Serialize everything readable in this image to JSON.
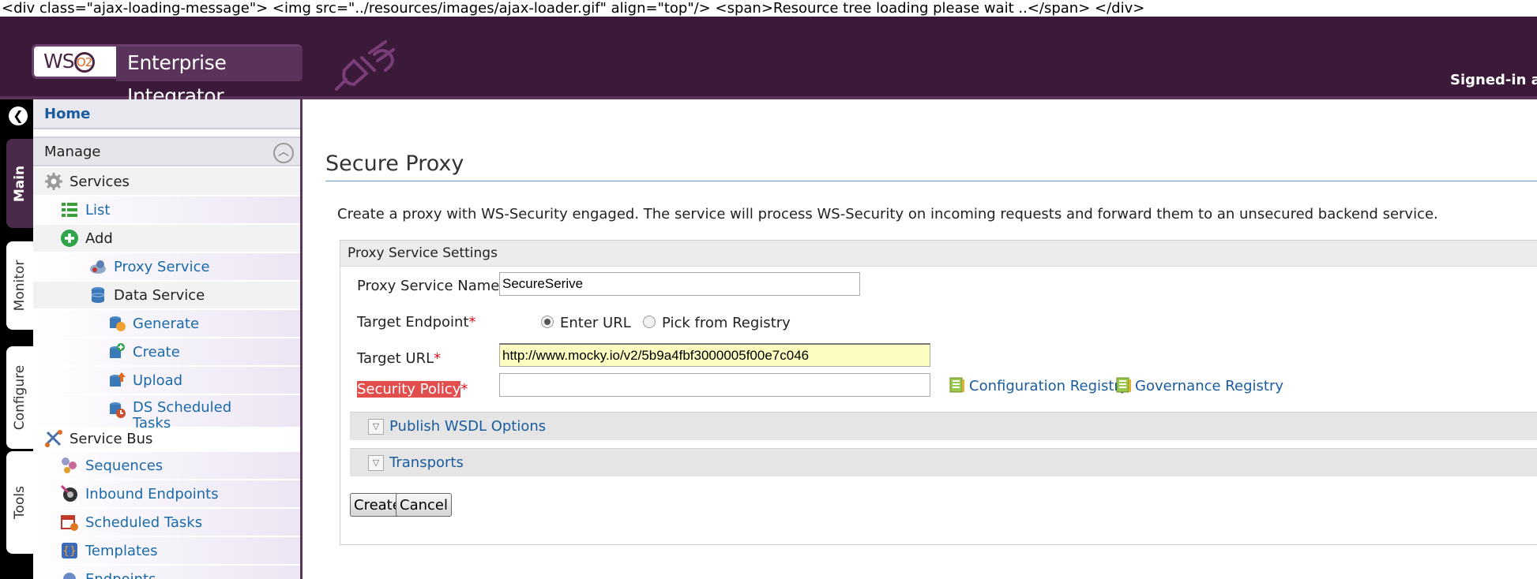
{
  "raw_markup_text": "<div class=\"ajax-loading-message\"> <img src=\"../resources/images/ajax-loader.gif\" align=\"top\"/> <span>Resource tree loading please wait ..</span> </div>",
  "header": {
    "logo_ws": "WS",
    "logo_o2": "O2",
    "logo_text": "Enterprise Integrator",
    "signed_in": "Signed-in a"
  },
  "side_tabs": [
    "Main",
    "Monitor",
    "Configure",
    "Tools"
  ],
  "sidebar": {
    "home": "Home",
    "manage": "Manage",
    "items": [
      {
        "label": "Services",
        "link": false,
        "icon": "gear-icon"
      },
      {
        "label": "List",
        "link": true,
        "icon": "list-icon"
      },
      {
        "label": "Add",
        "link": false,
        "icon": "add-icon"
      },
      {
        "label": "Proxy Service",
        "link": true,
        "icon": "proxy-service-icon"
      },
      {
        "label": "Data Service",
        "link": false,
        "icon": "database-icon"
      },
      {
        "label": "Generate",
        "link": true,
        "icon": "generate-icon"
      },
      {
        "label": "Create",
        "link": true,
        "icon": "create-icon"
      },
      {
        "label": "Upload",
        "link": true,
        "icon": "upload-icon"
      },
      {
        "label": "DS Scheduled",
        "label2": "Tasks",
        "link": true,
        "icon": "scheduled-tasks-icon"
      },
      {
        "label": "Service Bus",
        "link": false,
        "icon": "service-bus-icon"
      },
      {
        "label": "Sequences",
        "link": true,
        "icon": "sequences-icon"
      },
      {
        "label": "Inbound Endpoints",
        "link": true,
        "icon": "inbound-endpoints-icon"
      },
      {
        "label": "Scheduled Tasks",
        "link": true,
        "icon": "calendar-icon"
      },
      {
        "label": "Templates",
        "link": true,
        "icon": "templates-icon"
      },
      {
        "label": "Endpoints",
        "link": true,
        "icon": "endpoints-icon"
      }
    ]
  },
  "main": {
    "title": "Secure Proxy",
    "description": "Create a proxy with WS-Security engaged. The service will process WS-Security on incoming requests and forward them to an unsecured backend service.",
    "settings_header": "Proxy Service Settings",
    "proxy_name_label": "Proxy Service Name",
    "proxy_name_value": "SecureSerive",
    "target_endpoint_label": "Target Endpoint",
    "radio_enter_url": "Enter URL",
    "radio_pick_registry": "Pick from Registry",
    "target_url_label": "Target URL",
    "target_url_value": "http://www.mocky.io/v2/5b9a4fbf3000005f00e7c046",
    "security_policy_label": "Security Policy",
    "security_policy_value": "",
    "config_registry": "Configuration Registry",
    "governance_registry": "Governance Registry",
    "required_mark": "*",
    "publish_wsdl": "Publish WSDL Options",
    "transports": "Transports",
    "create_button": "Create",
    "cancel_button": "Cancel"
  },
  "colors": {
    "header_bg": "#3a1a38",
    "link": "#1a5c9e",
    "required": "#d8101c",
    "highlight": "#e24d4d",
    "url_field_bg": "#fdfcc0"
  }
}
